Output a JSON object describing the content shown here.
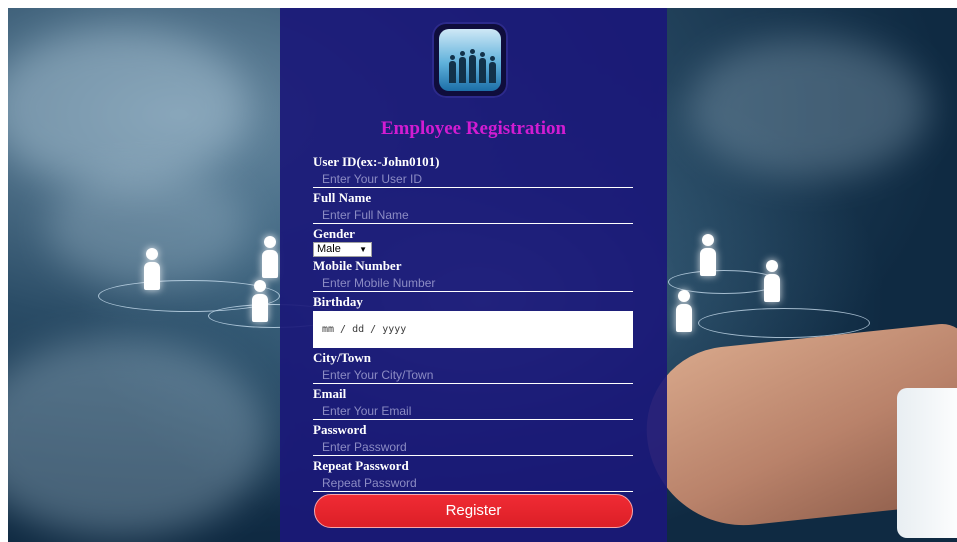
{
  "form": {
    "title": "Employee Registration",
    "fields": {
      "user_id": {
        "label": "User ID(ex:-John0101)",
        "placeholder": "Enter Your User ID",
        "value": ""
      },
      "full_name": {
        "label": "Full Name",
        "placeholder": "Enter Full Name",
        "value": ""
      },
      "gender": {
        "label": "Gender",
        "selected": "Male",
        "arrow": "▼"
      },
      "mobile": {
        "label": "Mobile Number",
        "placeholder": "Enter Mobile Number",
        "value": ""
      },
      "birthday": {
        "label": "Birthday",
        "placeholder": "mm / dd / yyyy"
      },
      "city": {
        "label": "City/Town",
        "placeholder": "Enter Your City/Town",
        "value": ""
      },
      "email": {
        "label": "Email",
        "placeholder": "Enter Your Email",
        "value": ""
      },
      "password": {
        "label": "Password",
        "placeholder": "Enter Password",
        "value": ""
      },
      "repeat_password": {
        "label": "Repeat Password",
        "placeholder": "Repeat Password",
        "value": ""
      }
    },
    "submit_label": "Register"
  },
  "colors": {
    "panel": "#1a1878",
    "title": "#d21cd2",
    "button": "#e4232b"
  },
  "icons": {
    "logo": "business-people-logo"
  }
}
